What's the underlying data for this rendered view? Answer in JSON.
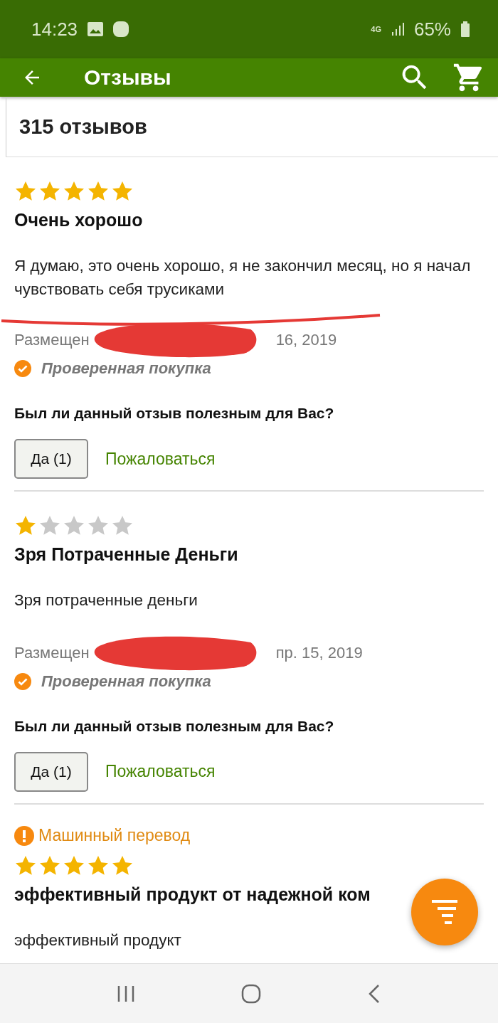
{
  "status_bar": {
    "time": "14:23",
    "network": "4G",
    "battery": "65%"
  },
  "app_bar": {
    "title": "Отзывы"
  },
  "header": {
    "count": "315 отзывов"
  },
  "reviews": [
    {
      "stars": 5,
      "title": "Очень хорошо",
      "body": "Я думаю, это очень хорошо, я не закончил месяц, но я начал чувствовать себя трусиками",
      "underlined": true,
      "posted_prefix": "Размещен",
      "posted_suffix": "16, 2019",
      "verified": "Проверенная покупка",
      "question": "Был ли данный отзыв полезным для Вас?",
      "helpful": "Да (1)",
      "report": "Пожаловаться"
    },
    {
      "stars": 1,
      "title": "Зря Потраченные Деньги",
      "body": "Зря потраченные деньги",
      "underlined": false,
      "posted_prefix": "Размещен",
      "posted_suffix": "пр. 15, 2019",
      "verified": "Проверенная покупка",
      "question": "Был ли данный отзыв полезным для Вас?",
      "helpful": "Да (1)",
      "report": "Пожаловаться"
    },
    {
      "stars": 5,
      "machine_translation": "Машинный перевод",
      "title": "эффективный продукт от надежной ком",
      "body": "эффективный продукт",
      "underlined": false
    }
  ]
}
